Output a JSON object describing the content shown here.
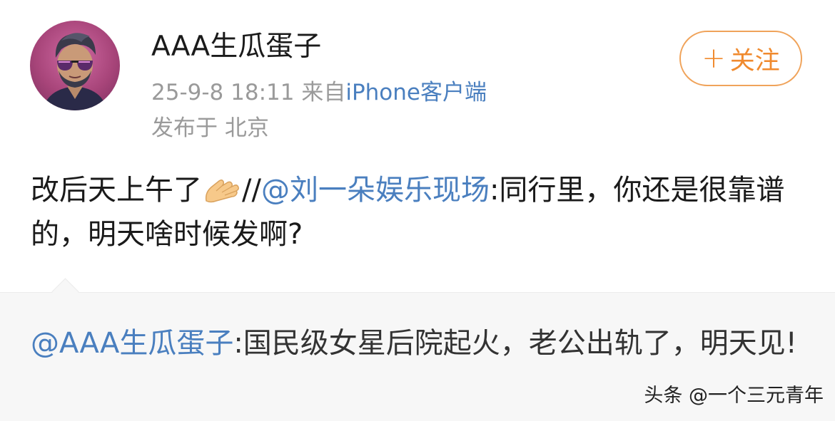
{
  "header": {
    "username": "AAA生瓜蛋子",
    "timestamp": "25-9-8 18:11",
    "source_prefix": "来自",
    "source": "iPhone客户端",
    "location": "发布于 北京",
    "follow_plus": "+",
    "follow_label": "关注"
  },
  "post": {
    "text_part1": "改后天上午了",
    "emoji_icon": "pinched-fingers-emoji",
    "separator": "//",
    "mention": "@刘一朵娱乐现场",
    "text_part2": ":同行里，你还是很靠谱的，明天啥时候发啊?"
  },
  "repost": {
    "mention": "@AAA生瓜蛋子",
    "text": ":国民级女星后院起火，老公出轨了，明天见!"
  },
  "watermark": "头条 @一个三元青年",
  "colors": {
    "link": "#4a7fbf",
    "follow_accent": "#f08a2e",
    "meta_gray": "#9a9a9a",
    "repost_bg": "#f7f7f7"
  }
}
